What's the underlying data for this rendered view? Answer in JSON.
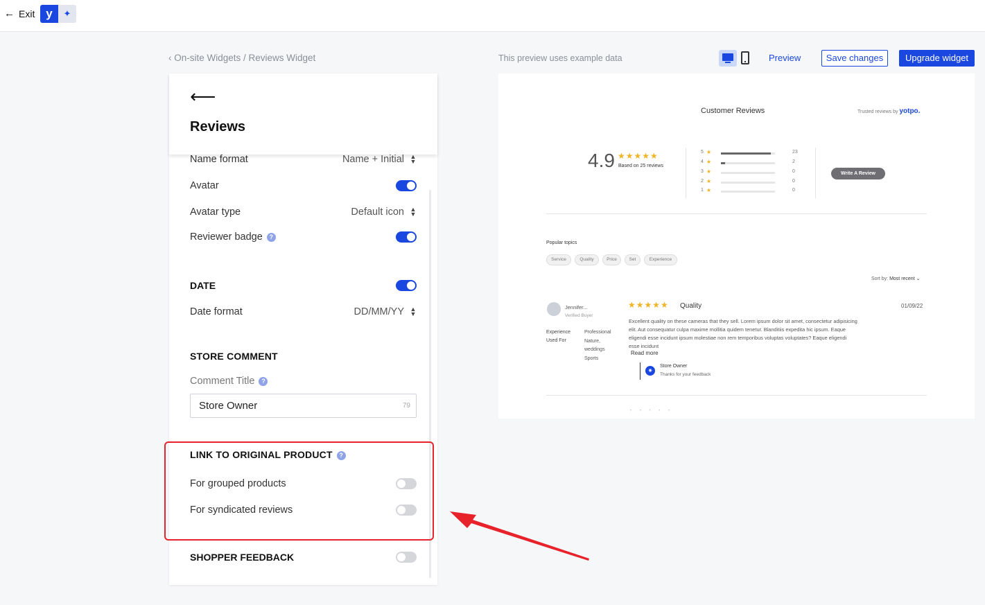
{
  "topbar": {
    "exit_label": "Exit",
    "logo_letter": "y",
    "ai_icon": "sparkle-icon"
  },
  "breadcrumb": "On-site Widgets / Reviews Widget",
  "preview_note": "This preview uses example data",
  "actions": {
    "preview": "Preview",
    "save": "Save changes",
    "upgrade": "Upgrade widget"
  },
  "panel": {
    "title": "Reviews",
    "name_format": {
      "label": "Name format",
      "value": "Name + Initial"
    },
    "avatar": {
      "label": "Avatar",
      "on": true
    },
    "avatar_type": {
      "label": "Avatar type",
      "value": "Default icon"
    },
    "reviewer_badge": {
      "label": "Reviewer badge",
      "on": true
    },
    "date": {
      "label": "DATE",
      "on": true
    },
    "date_format": {
      "label": "Date format",
      "value": "DD/MM/YY"
    },
    "store_comment": {
      "label": "STORE COMMENT",
      "comment_title_label": "Comment Title",
      "value": "Store Owner",
      "counter": "79"
    },
    "link_original": {
      "label": "LINK TO ORIGINAL PRODUCT",
      "grouped": "For grouped products",
      "syndicated": "For syndicated reviews"
    },
    "shopper_feedback": {
      "label": "SHOPPER FEEDBACK"
    }
  },
  "preview": {
    "title": "Customer Reviews",
    "trusted_prefix": "Trusted reviews by",
    "trusted_brand": "yotpo.",
    "score": "4.9",
    "stars": "★★★★★",
    "based_on": "Based on 25 reviews",
    "distribution": [
      {
        "star": "5",
        "count": "23",
        "fraction": 0.92
      },
      {
        "star": "4",
        "count": "2",
        "fraction": 0.08
      },
      {
        "star": "3",
        "count": "0",
        "fraction": 0
      },
      {
        "star": "2",
        "count": "0",
        "fraction": 0
      },
      {
        "star": "1",
        "count": "0",
        "fraction": 0
      }
    ],
    "write_review": "Write A Review",
    "popular_topics": "Popular topics",
    "topics": [
      "Service",
      "Quality",
      "Price",
      "Set",
      "Experience"
    ],
    "sort_by_label": "Sort by:",
    "sort_by_value": "Most recent ⌄",
    "review": {
      "name": "Jennifer...",
      "verified": "Verified Buyer",
      "k1": "Experience",
      "k2": "Used For",
      "v1": "Professional",
      "v2": "Nature,",
      "v3": "weddings",
      "v4": "Sports",
      "stars": "★★★★★",
      "title": "Quality",
      "date": "01/09/22",
      "body": "Excellent quality on these cameras that they sell. Lorem ipsum dolor sit amet, consectetur adipisicing elit. Aut consequatur culpa maxime mollitia quidem tenetur. Blanditiis expedita hic ipsum. Eaque eligendi esse incidunt ipsum molestiae non rem temporibus voluptas voluptates? Eaque eligendi esse incidunt",
      "read_more": "Read more",
      "reply_name": "Store Owner",
      "reply_text": "Thanks for your feedback"
    },
    "pagination": "• • • • •"
  },
  "colors": {
    "accent": "#1a47e0",
    "star": "#f0b323",
    "highlight": "#e8222a"
  }
}
